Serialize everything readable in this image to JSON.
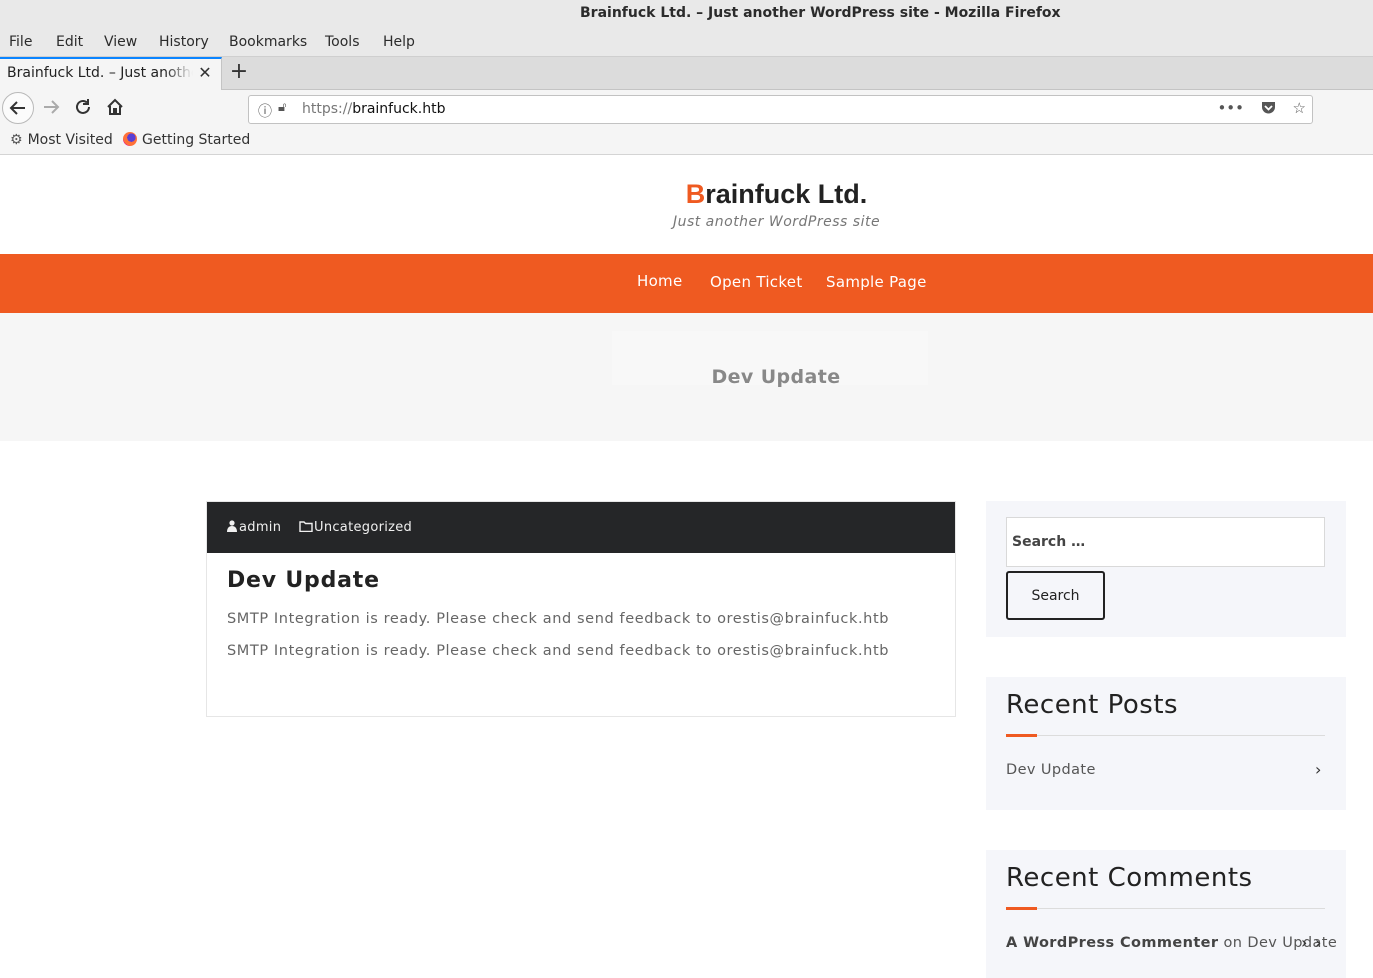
{
  "browser": {
    "window_title": "Brainfuck Ltd. – Just another WordPress site - Mozilla Firefox",
    "menu": [
      "File",
      "Edit",
      "View",
      "History",
      "Bookmarks",
      "Tools",
      "Help"
    ],
    "tab": {
      "title": "Brainfuck Ltd. – Just another WordPress site",
      "close": "✕"
    },
    "new_tab": "+",
    "url": {
      "protocol": "https://",
      "host": "brainfuck.htb"
    },
    "bookmarks": [
      "Most Visited",
      "Getting Started"
    ],
    "icons": {
      "back": "arrow-left",
      "forward": "arrow-right",
      "reload": "reload",
      "home": "home",
      "info": "info",
      "insecure_lock": "lock-warning",
      "page_actions": "more-dots",
      "pocket": "pocket",
      "bookmark_star": "star"
    }
  },
  "site": {
    "title_first": "B",
    "title_rest": "rainfuck Ltd.",
    "tagline": "Just another WordPress site",
    "accent_color": "#ef5a21",
    "nav": [
      "Home",
      "Open Ticket",
      "Sample Page"
    ],
    "hero_title": "Dev Update"
  },
  "post": {
    "author": "admin",
    "category": "Uncategorized",
    "title": "Dev Update",
    "paragraphs": [
      "SMTP Integration is ready. Please check and send feedback to orestis@brainfuck.htb",
      "SMTP Integration is ready. Please check and send feedback to orestis@brainfuck.htb"
    ]
  },
  "sidebar": {
    "search": {
      "placeholder": "Search …",
      "button": "Search"
    },
    "recent_posts": {
      "title": "Recent Posts",
      "items": [
        "Dev Update"
      ]
    },
    "recent_comments": {
      "title": "Recent Comments",
      "items": [
        {
          "author": "A WordPress Commenter",
          "joiner": "on",
          "post": "Dev Update"
        }
      ]
    }
  }
}
